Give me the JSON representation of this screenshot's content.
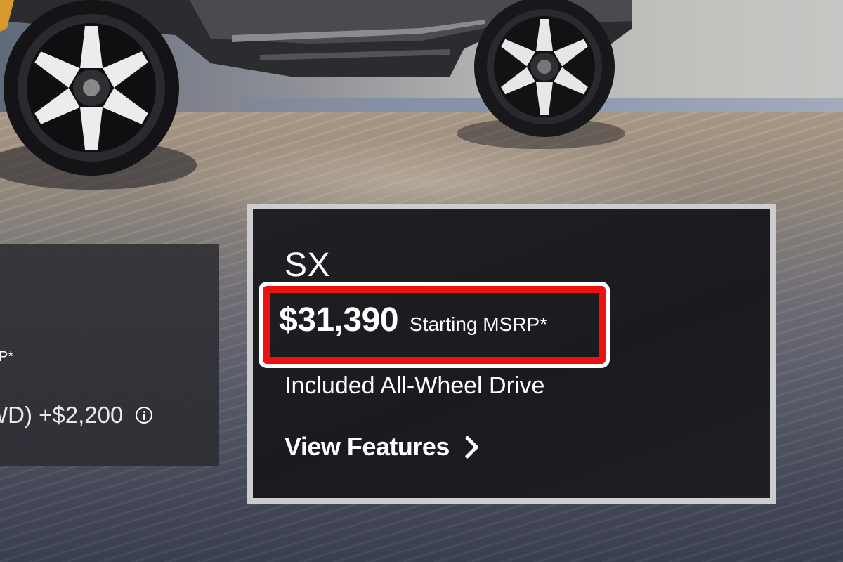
{
  "left_card": {
    "msrp_suffix": "P*",
    "awd_option": "WD) +$2,200",
    "info_icon": "info-icon"
  },
  "trim_card": {
    "name": "SX",
    "price": "$31,390",
    "price_label": "Starting MSRP*",
    "drive": "Included All-Wheel Drive",
    "cta_label": "View Features",
    "cta_icon": "chevron-right-icon"
  },
  "colors": {
    "highlight_red": "#ee1111",
    "card_background": "#1d1d21",
    "card_border": "#cdcdcf"
  }
}
